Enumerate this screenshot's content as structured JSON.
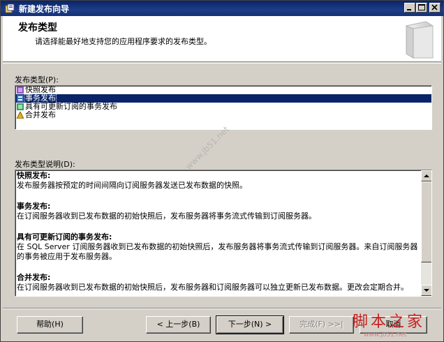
{
  "window": {
    "title": "新建发布向导"
  },
  "header": {
    "title": "发布类型",
    "description": "请选择能最好地支持您的应用程序要求的发布类型。"
  },
  "publication_type": {
    "label": "发布类型(P):",
    "items": [
      {
        "label": "快照发布",
        "icon": "snapshot-icon",
        "selected": false
      },
      {
        "label": "事务发布",
        "icon": "transaction-icon",
        "selected": true
      },
      {
        "label": "具有可更新订阅的事务发布",
        "icon": "updatable-icon",
        "selected": false
      },
      {
        "label": "合并发布",
        "icon": "merge-icon",
        "selected": false
      }
    ]
  },
  "description_box": {
    "label": "发布类型说明(D):",
    "sections": [
      {
        "heading": "快照发布:",
        "body": "发布服务器按预定的时间间隔向订阅服务器发送已发布数据的快照。"
      },
      {
        "heading": "事务发布:",
        "body": "在订阅服务器收到已发布数据的初始快照后，发布服务器将事务流式传输到订阅服务器。"
      },
      {
        "heading": "具有可更新订阅的事务发布:",
        "body": "在 SQL Server 订阅服务器收到已发布数据的初始快照后，发布服务器将事务流式传输到订阅服务器。来自订阅服务器的事务被应用于发布服务器。"
      },
      {
        "heading": "合并发布:",
        "body": "在订阅服务器收到已发布数据的初始快照后，发布服务器和订阅服务器可以独立更新已发布数据。更改会定期合并。"
      }
    ]
  },
  "buttons": {
    "help": "帮助(H)",
    "back": "< 上一步(B)",
    "next": "下一步(N) >",
    "finish": "完成(F) >>|",
    "cancel": "取消"
  },
  "watermark": {
    "text": "脚本之家",
    "sub": "www.jb51.net",
    "diagonal": "www.jb51.net"
  },
  "colors": {
    "titlebar": "#0a246a",
    "selection": "#0a246a",
    "face": "#d4d0c8"
  }
}
